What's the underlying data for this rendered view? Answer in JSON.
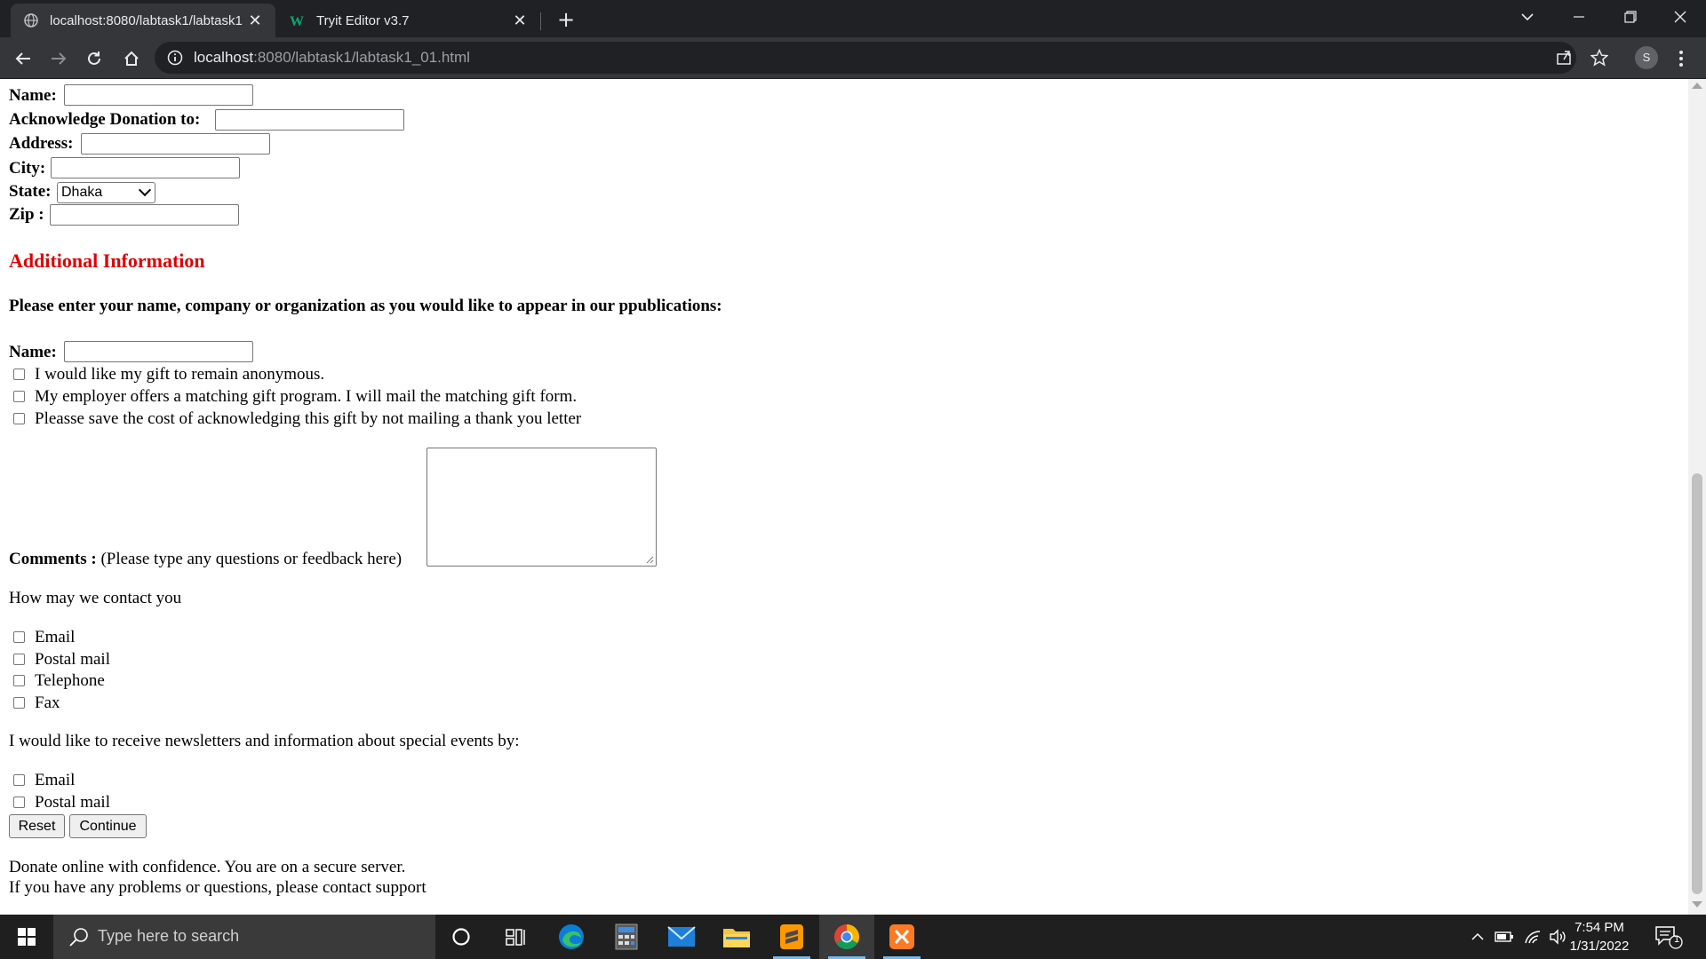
{
  "browser": {
    "tabs": [
      {
        "title": "localhost:8080/labtask1/labtask1",
        "icon": "globe-icon",
        "active": true
      },
      {
        "title": "Tryit Editor v3.7",
        "icon": "w3schools-icon",
        "active": false
      }
    ],
    "url_host": "localhost",
    "url_rest": ":8080/labtask1/labtask1_01.html",
    "profile_initial": "S"
  },
  "form": {
    "name_label": "Name:",
    "acknowledge_label": "Acknowledge Donation to:",
    "address_label": "Address:",
    "city_label": "City:",
    "state_label": "State:",
    "state_selected": "Dhaka",
    "zip_label": "Zip :",
    "additional_heading": "Additional Information",
    "publication_prompt": "Please enter your name, company or organization as you would like to appear in our ppublications:",
    "pub_name_label": "Name:",
    "gift_options": [
      "I would like my gift to remain anonymous.",
      "My employer offers a matching gift program. I will mail the matching gift form.",
      "Pleasse save the cost of acknowledging this gift by not mailing a thank you letter"
    ],
    "comments_label": "Comments :",
    "comments_hint": "(Please type any questions or feedback here)",
    "contact_prompt": "How may we contact you",
    "contact_options": [
      "Email",
      "Postal mail",
      "Telephone",
      "Fax"
    ],
    "newsletter_prompt": "I would like to receive newsletters and information about special events by:",
    "newsletter_options": [
      "Email",
      "Postal mail"
    ],
    "reset_label": "Reset",
    "continue_label": "Continue",
    "secure_note": "Donate online with confidence. You are on a secure server.",
    "support_note": "If you have any problems or questions, please contact support"
  },
  "taskbar": {
    "search_placeholder": "Type here to search",
    "time": "7:54 PM",
    "date": "1/31/2022",
    "notification_count": "1"
  }
}
